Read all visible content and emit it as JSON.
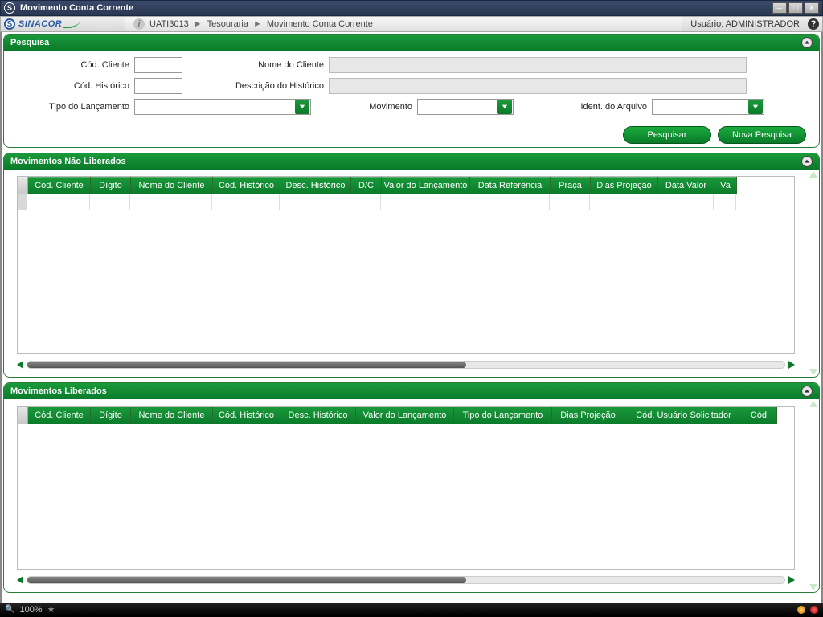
{
  "window": {
    "title": "Movimento Conta Corrente"
  },
  "ribbon": {
    "logo_text": "SINACOR",
    "breadcrumb": [
      "UATI3013",
      "Tesouraria",
      "Movimento Conta Corrente"
    ],
    "user_label": "Usuário:",
    "user_value": "ADMINISTRADOR"
  },
  "search_panel": {
    "title": "Pesquisa",
    "labels": {
      "cod_cliente": "Cód. Cliente",
      "nome_cliente": "Nome do Cliente",
      "cod_historico": "Cód. Histórico",
      "desc_historico": "Descrição do Histórico",
      "tipo_lancamento": "Tipo do Lançamento",
      "movimento": "Movimento",
      "ident_arquivo": "Ident. do Arquivo"
    },
    "values": {
      "cod_cliente": "",
      "nome_cliente": "",
      "cod_historico": "",
      "desc_historico": "",
      "tipo_lancamento": "",
      "movimento": "",
      "ident_arquivo": ""
    },
    "buttons": {
      "pesquisar": "Pesquisar",
      "nova_pesquisa": "Nova Pesquisa"
    }
  },
  "grid1": {
    "title": "Movimentos Não Liberados",
    "columns": [
      "Cód. Cliente",
      "Dígito",
      "Nome do Cliente",
      "Cód. Histórico",
      "Desc. Histórico",
      "D/C",
      "Valor do Lançamento",
      "Data Referência",
      "Praça",
      "Dias Projeção",
      "Data Valor",
      "Va"
    ],
    "widths": [
      78,
      50,
      102,
      84,
      88,
      38,
      110,
      100,
      50,
      84,
      70,
      28
    ],
    "rows": []
  },
  "grid2": {
    "title": "Movimentos Liberados",
    "columns": [
      "Cód. Cliente",
      "Dígito",
      "Nome do Cliente",
      "Cód. Histórico",
      "Desc. Histórico",
      "Valor do Lançamento",
      "Tipo do Lançamento",
      "Dias Projeção",
      "Cód. Usuário Solicitador",
      "Cód."
    ],
    "widths": [
      78,
      50,
      102,
      84,
      94,
      122,
      122,
      90,
      148,
      42
    ],
    "rows": []
  },
  "status": {
    "zoom": "100%"
  }
}
